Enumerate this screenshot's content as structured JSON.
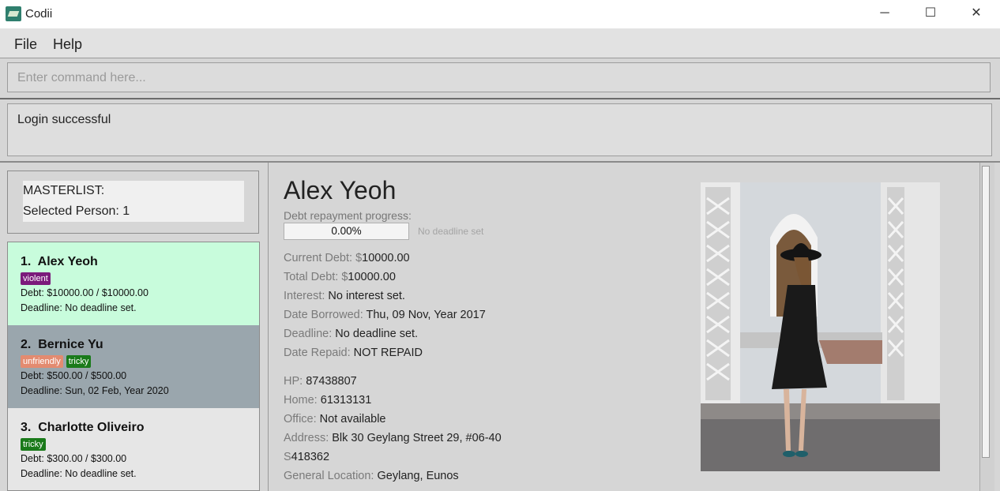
{
  "window": {
    "title": "Codii",
    "minimize_glyph": "─",
    "maximize_glyph": "☐",
    "close_glyph": "✕"
  },
  "menu": {
    "file": "File",
    "help": "Help"
  },
  "command": {
    "placeholder": "Enter command here..."
  },
  "result": {
    "message": "Login successful"
  },
  "masterlist": {
    "title": "MASTERLIST:",
    "selected": "Selected Person: 1"
  },
  "persons": [
    {
      "index": "1.",
      "name": "Alex Yeoh",
      "tags": [
        {
          "label": "violent",
          "color": "#7b1a7b"
        }
      ],
      "debt": "Debt: $10000.00 / $10000.00",
      "deadline": "Deadline: No deadline set.",
      "bg": "#c8fcdc"
    },
    {
      "index": "2.",
      "name": "Bernice Yu",
      "tags": [
        {
          "label": "unfriendly",
          "color": "#e38b70"
        },
        {
          "label": "tricky",
          "color": "#1a7a1a"
        }
      ],
      "debt": "Debt: $500.00 / $500.00",
      "deadline": "Deadline: Sun, 02 Feb, Year 2020",
      "bg": "#9aa6ad"
    },
    {
      "index": "3.",
      "name": "Charlotte Oliveiro",
      "tags": [
        {
          "label": "tricky",
          "color": "#1a7a1a"
        }
      ],
      "debt": "Debt: $300.00 / $300.00",
      "deadline": "Deadline: No deadline set.",
      "bg": "#e6e6e6"
    }
  ],
  "detail": {
    "name": "Alex Yeoh",
    "progress_label": "Debt repayment progress:",
    "progress_value": "0.00%",
    "progress_fraction": 0.0,
    "progress_deadline": "No deadline set",
    "current_debt_label": "Current Debt: $",
    "current_debt": "10000.00",
    "total_debt_label": "Total Debt: $",
    "total_debt": "10000.00",
    "interest_label": "Interest: ",
    "interest": "No interest set.",
    "date_borrowed_label": "Date Borrowed: ",
    "date_borrowed": "Thu, 09 Nov, Year 2017",
    "deadline_label": "Deadline: ",
    "deadline": "No deadline set.",
    "date_repaid_label": "Date Repaid: ",
    "date_repaid": "NOT REPAID",
    "hp_label": "HP: ",
    "hp": "87438807",
    "home_label": "Home: ",
    "home": "61313131",
    "office_label": "Office: ",
    "office": "Not available",
    "address_label": "Address: ",
    "address": "Blk 30 Geylang Street 29, #06-40",
    "postal_prefix": "S",
    "postal": "418362",
    "location_label": "General Location: ",
    "location": "Geylang, Eunos"
  }
}
